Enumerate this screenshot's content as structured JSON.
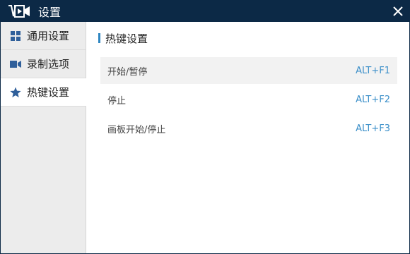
{
  "window": {
    "title": "设置",
    "app_icon": "video-camera-logo-icon",
    "close_icon": "close-icon"
  },
  "sidebar": {
    "items": [
      {
        "label": "通用设置",
        "icon": "grid-icon"
      },
      {
        "label": "录制选项",
        "icon": "camera-icon"
      },
      {
        "label": "热键设置",
        "icon": "star-icon",
        "active": true
      }
    ]
  },
  "content": {
    "section_title": "热键设置",
    "hotkeys": [
      {
        "label": "开始/暂停",
        "value": "ALT+F1"
      },
      {
        "label": "停止",
        "value": "ALT+F2"
      },
      {
        "label": "画板开始/停止",
        "value": "ALT+F3"
      }
    ]
  },
  "colors": {
    "titlebar": "#0c2946",
    "accent": "#3b8fc9",
    "sidebar_bg": "#ececec",
    "icon_blue": "#2f5f9a"
  }
}
